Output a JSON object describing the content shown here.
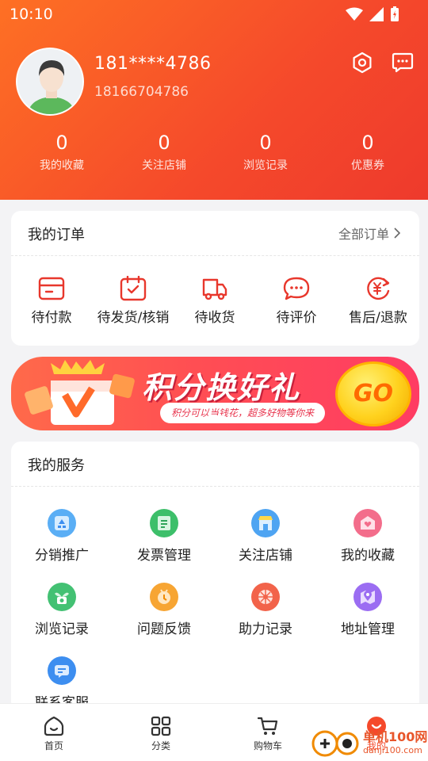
{
  "status_bar": {
    "time": "10:10"
  },
  "profile": {
    "username": "181****4786",
    "phone": "18166704786"
  },
  "stats": [
    {
      "value": "0",
      "label": "我的收藏"
    },
    {
      "value": "0",
      "label": "关注店铺"
    },
    {
      "value": "0",
      "label": "浏览记录"
    },
    {
      "value": "0",
      "label": "优惠券"
    }
  ],
  "orders": {
    "title": "我的订单",
    "more": "全部订单",
    "items": [
      {
        "label": "待付款",
        "icon": "wallet-icon"
      },
      {
        "label": "待发货/核销",
        "icon": "calendar-check-icon"
      },
      {
        "label": "待收货",
        "icon": "truck-icon"
      },
      {
        "label": "待评价",
        "icon": "chat-bubble-icon"
      },
      {
        "label": "售后/退款",
        "icon": "refund-icon"
      }
    ]
  },
  "banner": {
    "title": "积分换好礼",
    "subtitle": "积分可以当钱花，超多好物等你来",
    "button": "GO"
  },
  "services": {
    "title": "我的服务",
    "items": [
      {
        "label": "分销推广",
        "icon": "distribution-icon",
        "color": "#5aaef5"
      },
      {
        "label": "发票管理",
        "icon": "invoice-icon",
        "color": "#3dbf6a"
      },
      {
        "label": "关注店铺",
        "icon": "store-icon",
        "color": "#4ea4f2"
      },
      {
        "label": "我的收藏",
        "icon": "favorite-icon",
        "color": "#f36d8b"
      },
      {
        "label": "浏览记录",
        "icon": "history-icon",
        "color": "#43c173"
      },
      {
        "label": "问题反馈",
        "icon": "feedback-icon",
        "color": "#f7a533"
      },
      {
        "label": "助力记录",
        "icon": "assist-icon",
        "color": "#f2634a"
      },
      {
        "label": "地址管理",
        "icon": "location-icon",
        "color": "#9b6df2"
      },
      {
        "label": "联系客服",
        "icon": "customer-service-icon",
        "color": "#3d8ef0"
      }
    ]
  },
  "tabbar": {
    "items": [
      {
        "label": "首页",
        "icon": "home-icon"
      },
      {
        "label": "分类",
        "icon": "grid-icon"
      },
      {
        "label": "购物车",
        "icon": "cart-icon"
      },
      {
        "label": "我的",
        "icon": "user-icon"
      }
    ]
  },
  "watermark": {
    "text": "单机100网",
    "url": "danji100.com"
  },
  "colors": {
    "brand": "#f5492b",
    "brand_light": "#fe7024",
    "background": "#f3f3f5"
  }
}
